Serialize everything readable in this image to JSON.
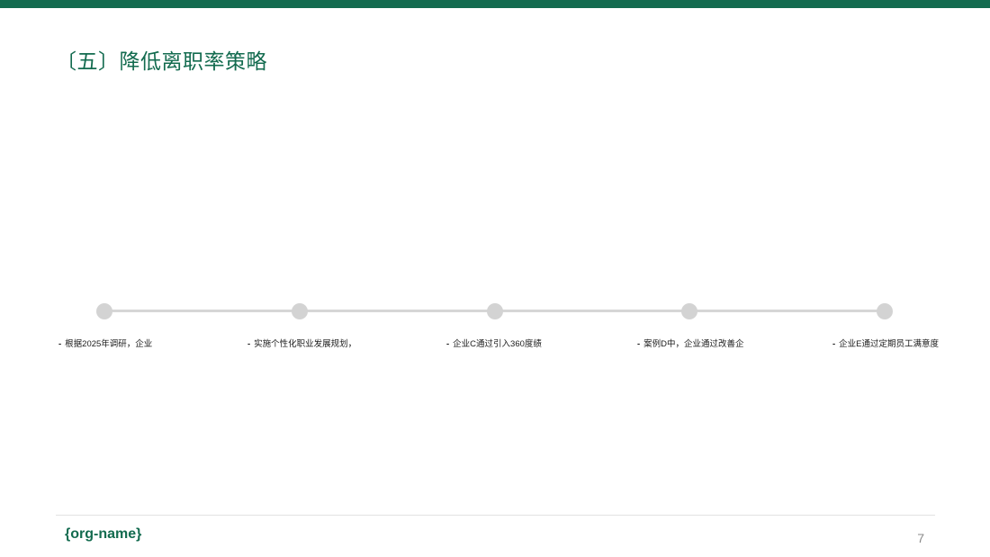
{
  "colors": {
    "brand": "#136b4f",
    "node": "#d3d3d3",
    "line": "#d6d6d6"
  },
  "slide": {
    "title": "〔五〕降低离职率策略"
  },
  "timeline": {
    "steps": [
      {
        "bullet": "-",
        "text": "根据2025年调研，企业"
      },
      {
        "bullet": "-",
        "text": "实施个性化职业发展规划，"
      },
      {
        "bullet": "-",
        "text": "企业C通过引入360度绩"
      },
      {
        "bullet": "-",
        "text": "案例D中，企业通过改善企"
      },
      {
        "bullet": "-",
        "text": "企业E通过定期员工满意度"
      }
    ]
  },
  "footer": {
    "org_name": "{org-name}",
    "page_number": "7"
  }
}
